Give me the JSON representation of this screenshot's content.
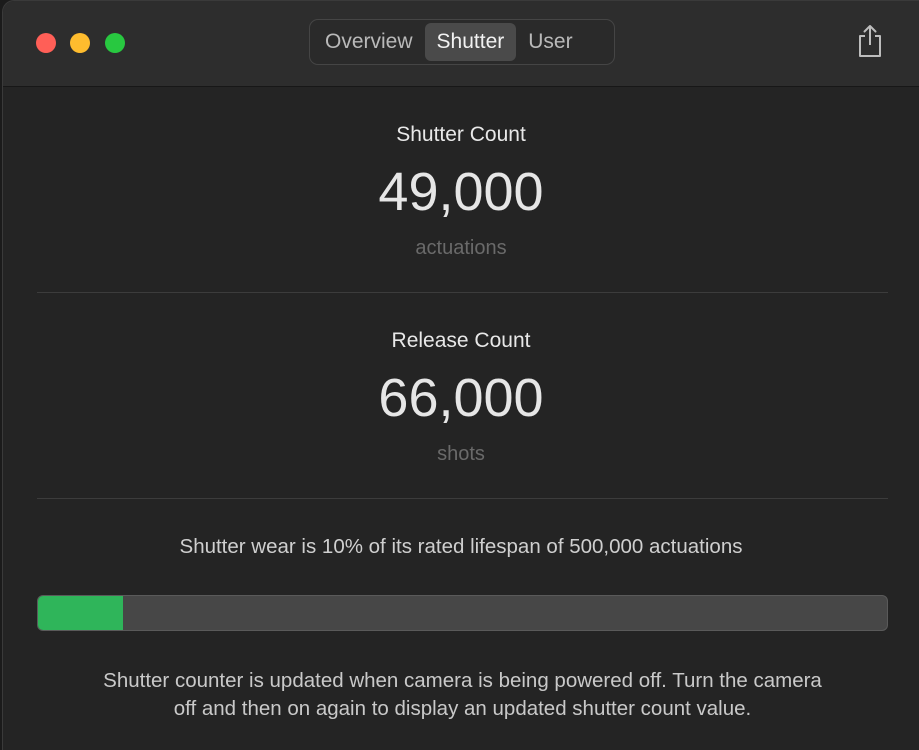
{
  "window": {
    "tabs": [
      {
        "label": "Overview",
        "active": false
      },
      {
        "label": "Shutter",
        "active": true
      },
      {
        "label": "User",
        "active": false
      }
    ],
    "share_icon": "share-icon"
  },
  "shutter_count": {
    "title": "Shutter Count",
    "value": "49,000",
    "unit": "actuations"
  },
  "release_count": {
    "title": "Release Count",
    "value": "66,000",
    "unit": "shots"
  },
  "wear": {
    "text": "Shutter wear is 10% of its rated lifespan of 500,000 actuations",
    "percent": 10
  },
  "note": {
    "line1": "Shutter counter is updated when camera is being powered off. Turn the camera",
    "line2": "off and then on again to display an updated shutter count value."
  },
  "colors": {
    "progress_fill": "#2fb55a",
    "close": "#ff5f57",
    "minimize": "#febc2e",
    "zoom": "#28c840"
  }
}
